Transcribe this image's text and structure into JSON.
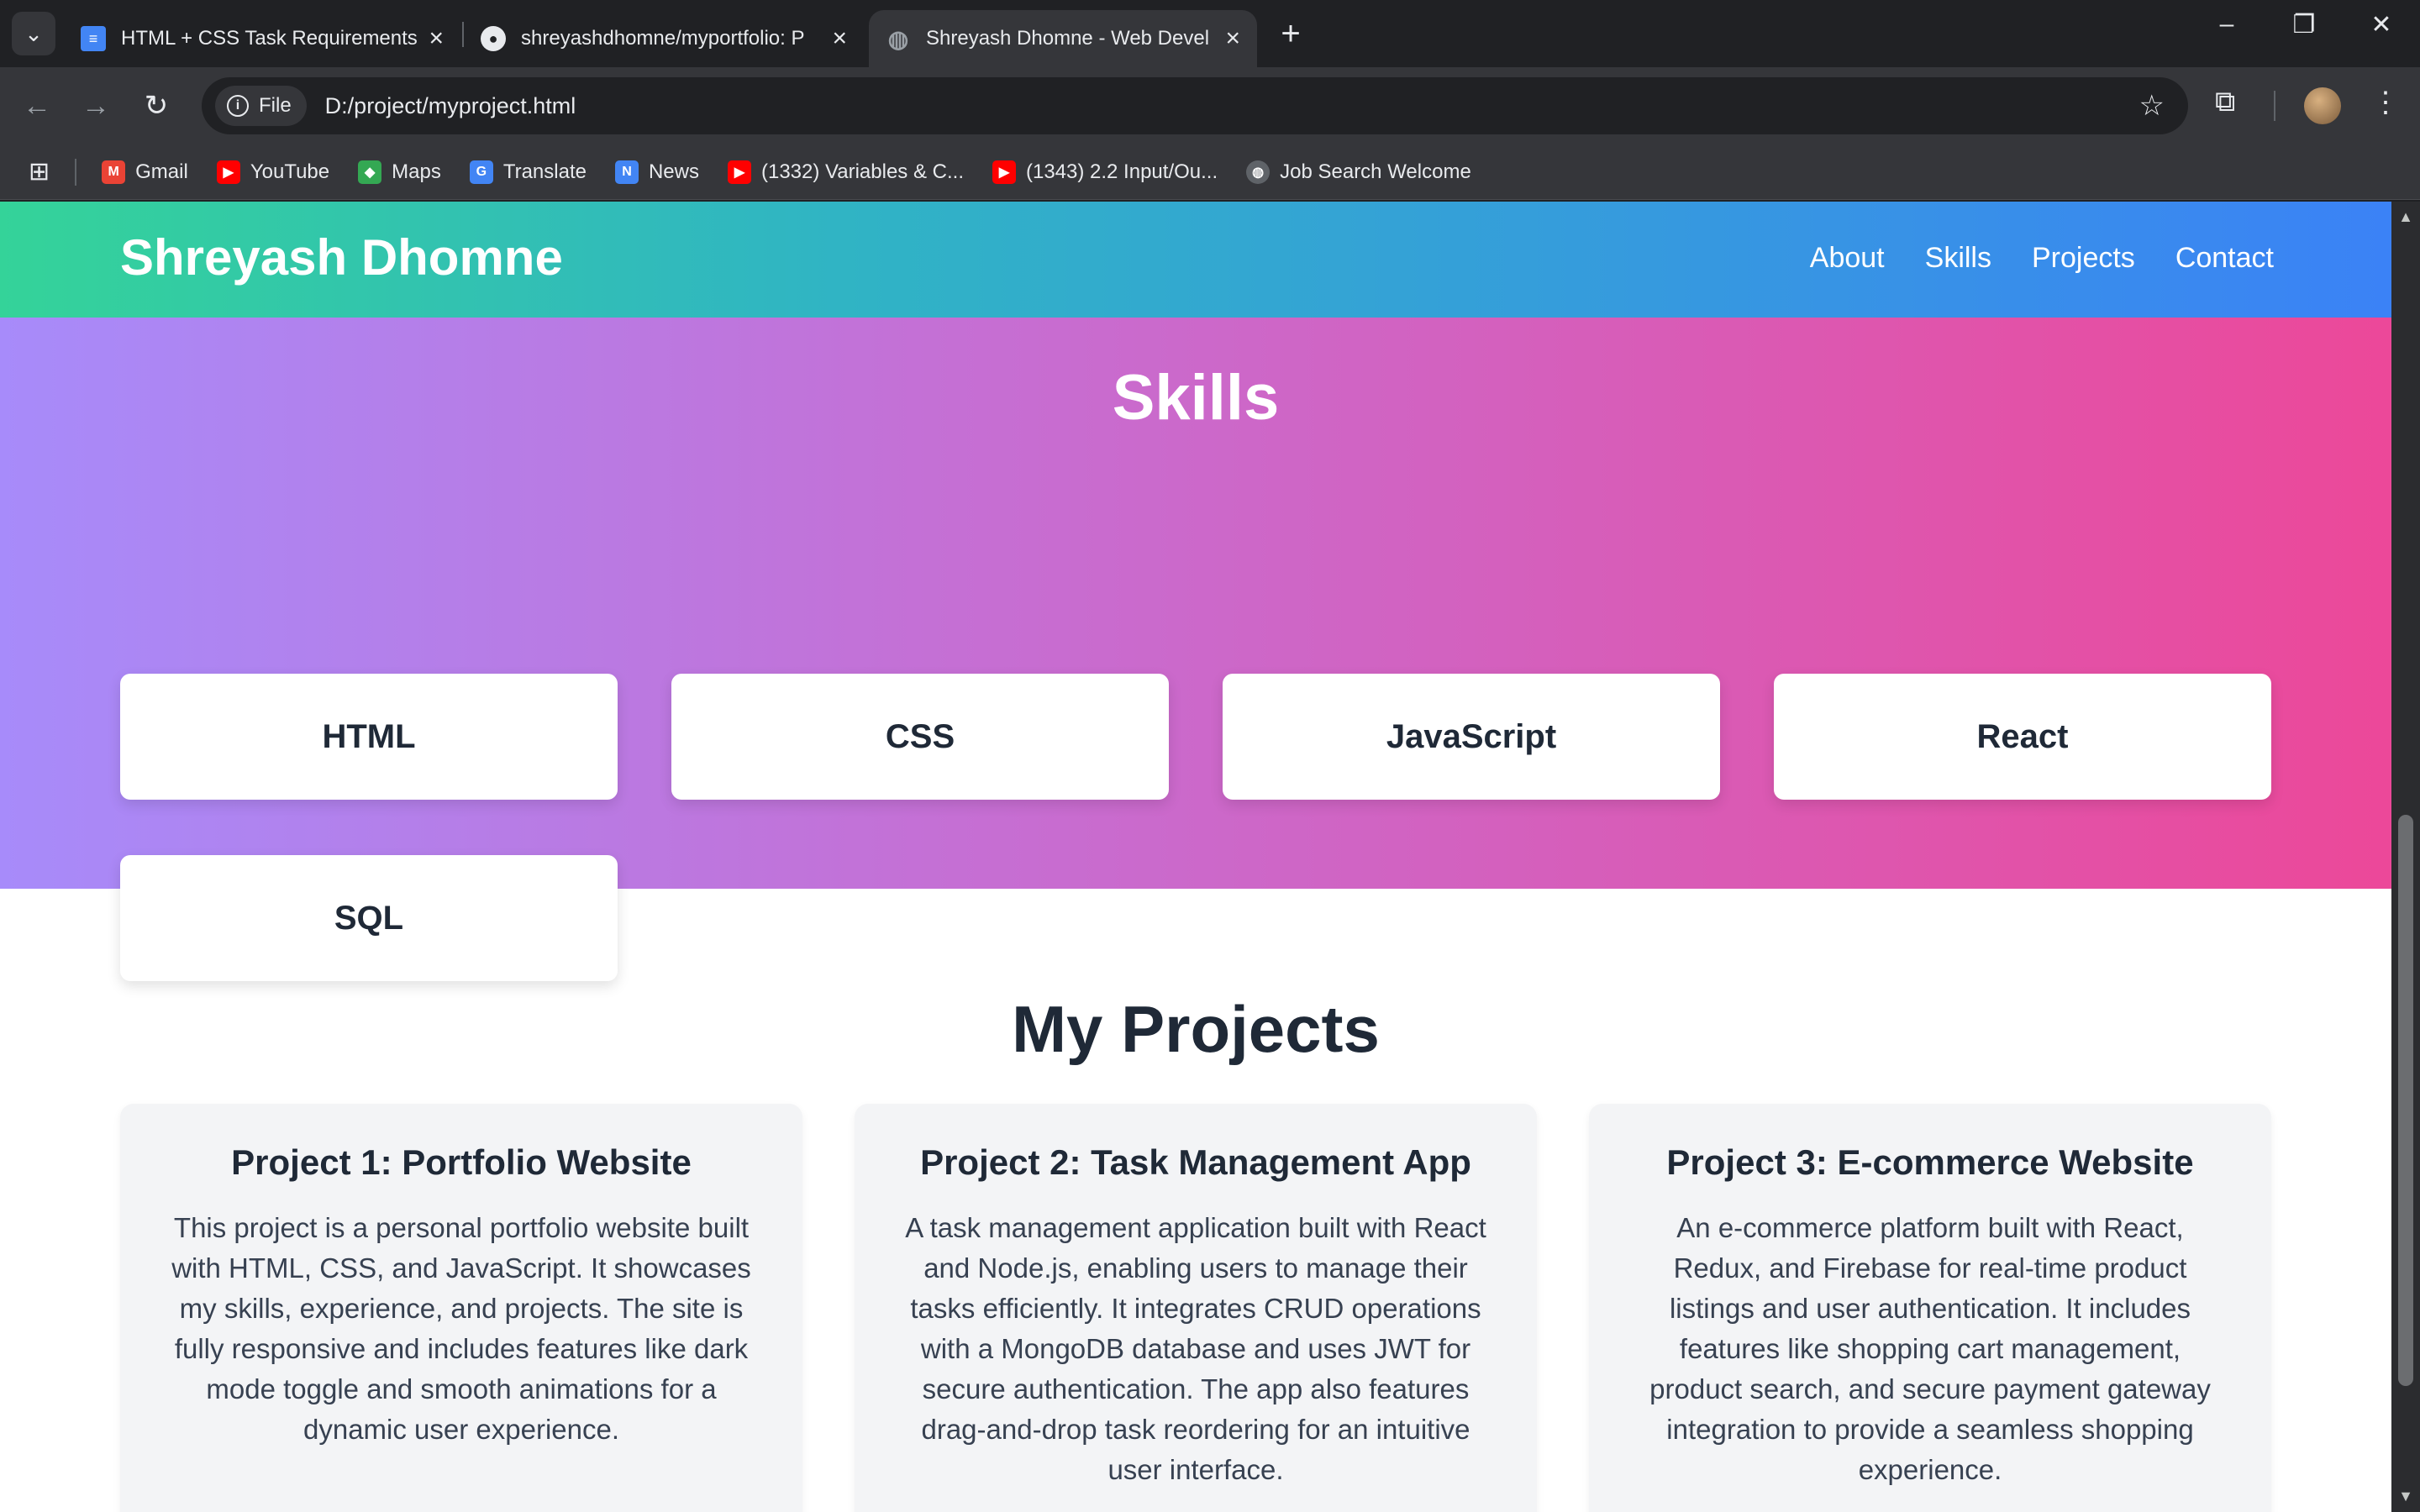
{
  "browser": {
    "tabs": [
      {
        "title": "HTML + CSS Task Requirements",
        "icon": "docs-icon",
        "active": false
      },
      {
        "title": "shreyashdhomne/myportfolio: P",
        "icon": "github-icon",
        "active": false
      },
      {
        "title": "Shreyash Dhomne - Web Devel",
        "icon": "globe-icon",
        "active": true
      }
    ],
    "site_info_chip": "File",
    "url": "D:/project/myproject.html",
    "bookmarks": [
      {
        "label": "Gmail",
        "icon": "gmail-icon",
        "color": "#ea4335"
      },
      {
        "label": "YouTube",
        "icon": "youtube-icon",
        "color": "#ff0000"
      },
      {
        "label": "Maps",
        "icon": "maps-icon",
        "color": "#34a853"
      },
      {
        "label": "Translate",
        "icon": "translate-icon",
        "color": "#4285f4"
      },
      {
        "label": "News",
        "icon": "news-icon",
        "color": "#4285f4"
      },
      {
        "label": "(1332) Variables & C...",
        "icon": "youtube-icon",
        "color": "#ff0000"
      },
      {
        "label": "(1343) 2.2 Input/Ou...",
        "icon": "youtube-icon",
        "color": "#ff0000"
      },
      {
        "label": "Job Search Welcome",
        "icon": "globe-icon",
        "color": "#9aa0a6"
      }
    ]
  },
  "site": {
    "title": "Shreyash Dhomne",
    "nav": [
      "About",
      "Skills",
      "Projects",
      "Contact"
    ]
  },
  "skills": {
    "heading": "Skills",
    "items": [
      "HTML",
      "CSS",
      "JavaScript",
      "React",
      "SQL"
    ]
  },
  "projects": {
    "heading": "My Projects",
    "items": [
      {
        "title": "Project 1: Portfolio Website",
        "description": "This project is a personal portfolio website built with HTML, CSS, and JavaScript. It showcases my skills, experience, and projects. The site is fully responsive and includes features like dark mode toggle and smooth animations for a dynamic user experience."
      },
      {
        "title": "Project 2: Task Management App",
        "description": "A task management application built with React and Node.js, enabling users to manage their tasks efficiently. It integrates CRUD operations with a MongoDB database and uses JWT for secure authentication. The app also features drag-and-drop task reordering for an intuitive user interface."
      },
      {
        "title": "Project 3: E-commerce Website",
        "description": "An e-commerce platform built with React, Redux, and Firebase for real-time product listings and user authentication. It includes features like shopping cart management, product search, and secure payment gateway integration to provide a seamless shopping experience."
      }
    ]
  }
}
